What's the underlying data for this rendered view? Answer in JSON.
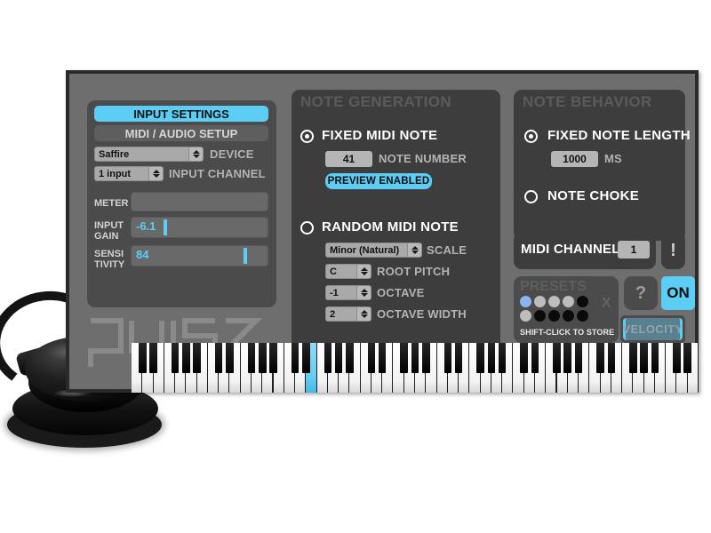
{
  "window": {
    "plugin_name": "pulse"
  },
  "input_settings": {
    "tabs": [
      {
        "label": "INPUT SETTINGS",
        "active": true
      },
      {
        "label": "MIDI / AUDIO SETUP",
        "active": false
      }
    ],
    "device": {
      "value": "Saffire",
      "label": "DEVICE"
    },
    "input_channel": {
      "value": "1 input",
      "label": "INPUT CHANNEL"
    },
    "meter": {
      "label": "METER",
      "value": ""
    },
    "input_gain": {
      "label_line1": "INPUT",
      "label_line2": "GAIN",
      "value": "-6.1",
      "percent": 22
    },
    "sensitivity": {
      "label_line1": "SENSI",
      "label_line2": "TIVITY",
      "value": "84",
      "percent": 84
    }
  },
  "note_generation": {
    "title": "NOTE GENERATION",
    "fixed": {
      "label": "FIXED MIDI NOTE",
      "selected": true,
      "note_number": "41",
      "note_number_label": "NOTE NUMBER",
      "preview_label": "PREVIEW ENABLED"
    },
    "random": {
      "label": "RANDOM MIDI NOTE",
      "selected": false,
      "scale": {
        "value": "Minor (Natural)",
        "label": "SCALE"
      },
      "root_pitch": {
        "value": "C",
        "label": "ROOT PITCH"
      },
      "octave": {
        "value": "-1",
        "label": "OCTAVE"
      },
      "octave_width": {
        "value": "2",
        "label": "OCTAVE WIDTH"
      }
    }
  },
  "note_behavior": {
    "title": "NOTE BEHAVIOR",
    "fixed_length": {
      "label": "FIXED NOTE LENGTH",
      "selected": true,
      "value": "1000",
      "unit": "MS"
    },
    "note_choke": {
      "label": "NOTE CHOKE",
      "selected": false
    }
  },
  "midi_channel": {
    "label": "MIDI CHANNEL",
    "value": "1"
  },
  "panic_button": {
    "glyph": "!"
  },
  "help_button": {
    "glyph": "?"
  },
  "power_button": {
    "label": "ON",
    "active": true
  },
  "velocity_button": {
    "label": "VELOCITY",
    "active": false
  },
  "presets": {
    "title": "PRESETS",
    "hint": "SHIFT-CLICK TO STORE",
    "clear_glyph": "X",
    "slots_row1": [
      "#8ab4f0",
      "#bdbdbd",
      "#bdbdbd",
      "#bdbdbd",
      "#0a0a0a"
    ],
    "slots_row2": [
      "#bdbdbd",
      "#0a0a0a",
      "#0a0a0a",
      "#0a0a0a",
      "#0a0a0a"
    ]
  },
  "keyboard": {
    "white_key_count": 52,
    "lit_white_key_index": 16
  },
  "colors": {
    "accent": "#5ccdf5",
    "panel": "#3d3d3d",
    "panel_light": "#4b4b4b",
    "window_bg": "#6e6e6e",
    "frame": "#2a2a2a",
    "title_text": "#5b5b5b"
  }
}
